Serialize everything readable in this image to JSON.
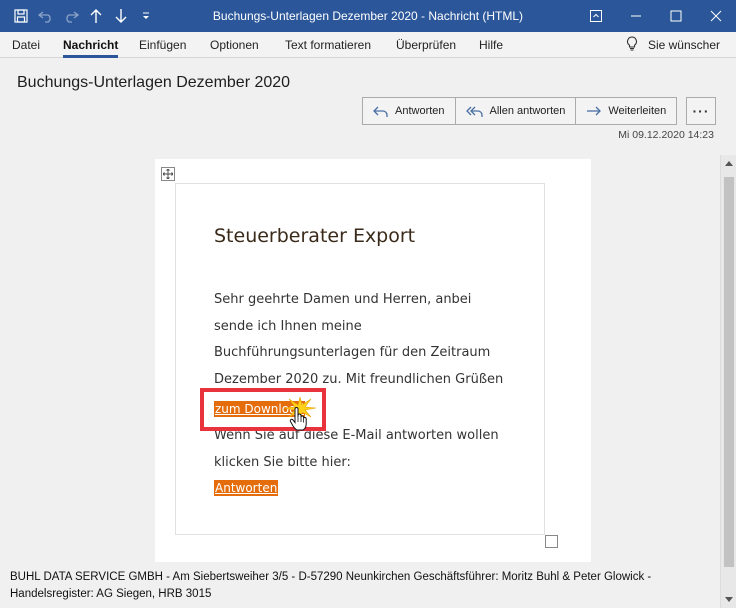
{
  "window": {
    "title": "Buchungs-Unterlagen Dezember 2020  -  Nachricht (HTML)"
  },
  "qat": {
    "icons": [
      "save-icon",
      "undo-icon",
      "redo-icon",
      "up-arrow-icon",
      "down-arrow-icon",
      "customize-icon"
    ]
  },
  "menu": {
    "items": [
      {
        "label": "Datei"
      },
      {
        "label": "Nachricht"
      },
      {
        "label": "Einfügen"
      },
      {
        "label": "Optionen"
      },
      {
        "label": "Text formatieren"
      },
      {
        "label": "Überprüfen"
      },
      {
        "label": "Hilfe"
      }
    ],
    "active": "Nachricht",
    "tellme": "Sie wünscher"
  },
  "header": {
    "subject": "Buchungs-Unterlagen Dezember 2020",
    "reply": "Antworten",
    "reply_all": "Allen antworten",
    "forward": "Weiterleiten",
    "more": "···",
    "datetime": "Mi 09.12.2020 14:23"
  },
  "mail": {
    "heading": "Steuerberater Export",
    "paragraph": "Sehr geehrte Damen und Herren, anbei sende ich Ihnen meine Buchführungsunterlagen für den Zeitraum Dezember 2020 zu. Mit freundlichen Grüßen",
    "download_link": "zum Download",
    "reply_text": "Wenn Sie auf diese E-Mail antworten wollen klicken Sie bitte hier:",
    "reply_link": "Antworten"
  },
  "footer": {
    "line1": "BUHL DATA SERVICE GMBH - Am Siebertsweiher 3/5 - D-57290 Neunkirchen Geschäftsführer: Moritz Buhl & Peter Glowick -",
    "line2": "Handelsregister: AG Siegen, HRB 3015"
  },
  "colors": {
    "titlebar": "#2b579a",
    "link_bg": "#e46c0a",
    "highlight": "#e8323c"
  }
}
